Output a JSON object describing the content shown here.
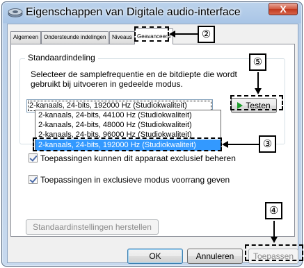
{
  "window": {
    "title": "Eigenschappen van Digitale audio-interface",
    "close_label": "X"
  },
  "tabs": [
    {
      "label": "Algemeen"
    },
    {
      "label": "Ondersteunde indelingen"
    },
    {
      "label": "Niveaus"
    },
    {
      "label": "Geavanceerd"
    }
  ],
  "default_format": {
    "group_label": "Standaardindeling",
    "description": "Selecteer de samplefrequentie en de bitdiepte die wordt gebruikt bij uitvoeren in gedeelde modus.",
    "selected_value": "2-kanaals, 24-bits, 192000 Hz (Studiokwaliteit)",
    "options": [
      "2-kanaals, 24-bits, 44100 Hz (Studiokwaliteit)",
      "2-kanaals, 24-bits, 48000 Hz (Studiokwaliteit)",
      "2-kanaals, 24-bits, 96000 Hz (Studiokwaliteit)",
      "2-kanaals, 24-bits, 192000 Hz (Studiokwaliteit)"
    ],
    "test_label": "Testen"
  },
  "exclusive": {
    "allow_control_label": "Toepassingen kunnen dit apparaat exclusief beheren",
    "priority_label": "Toepassingen in exclusieve modus voorrang geven"
  },
  "buttons": {
    "restore_defaults": "Standaardinstellingen herstellen",
    "ok": "OK",
    "cancel": "Annuleren",
    "apply": "Toepassen"
  },
  "callouts": {
    "c2": "②",
    "c3": "③",
    "c4": "④",
    "c5": "⑤"
  },
  "colors": {
    "selection": "#3399ff",
    "play_icon": "#1e9e2c"
  }
}
